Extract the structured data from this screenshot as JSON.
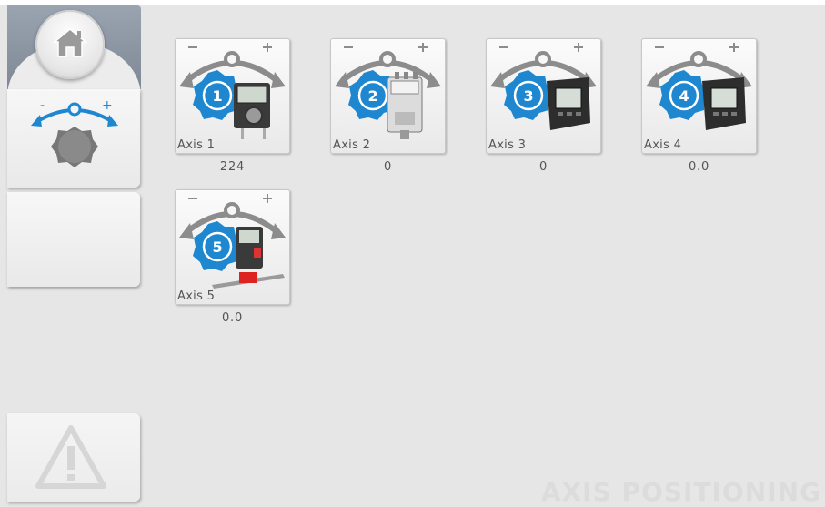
{
  "page_title": "AXIS POSITIONING",
  "sidebar": {
    "home_icon": "home-icon",
    "axis_icon": "axis-knob-icon",
    "warning_icon": "warning-icon"
  },
  "axes": [
    {
      "label": "Axis 1",
      "number": "1",
      "value": "224",
      "device": "digital-position-indicator"
    },
    {
      "label": "Axis 2",
      "number": "2",
      "value": "0",
      "device": "motor-drive-unit"
    },
    {
      "label": "Axis 3",
      "number": "3",
      "value": "0",
      "device": "electronic-indicator"
    },
    {
      "label": "Axis 4",
      "number": "4",
      "value": "0.0",
      "device": "electronic-indicator"
    },
    {
      "label": "Axis 5",
      "number": "5",
      "value": "0.0",
      "device": "indicator-with-linear-scale"
    }
  ],
  "colors": {
    "accent_blue": "#1e87d0",
    "background": "#e6e6e6",
    "arrow_gray": "#8c8c8c"
  }
}
